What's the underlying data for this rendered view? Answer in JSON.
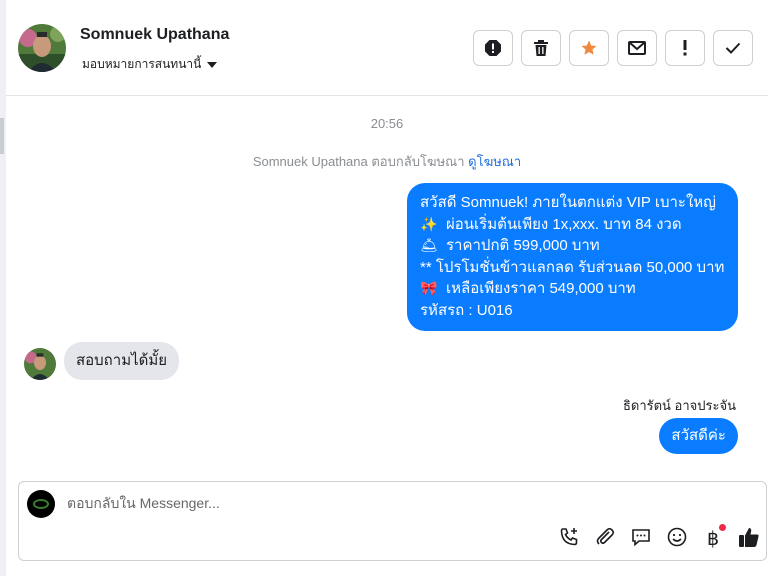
{
  "header": {
    "name": "Somnuek Upathana",
    "assign_label": "มอบหมายการสนทนานี้",
    "actions": [
      {
        "icon": "report-spam-icon"
      },
      {
        "icon": "trash-icon"
      },
      {
        "icon": "star-icon"
      },
      {
        "icon": "envelope-icon"
      },
      {
        "icon": "exclamation-icon"
      },
      {
        "icon": "checkmark-icon"
      }
    ]
  },
  "chat": {
    "timestamp": "20:56",
    "reply_note": "Somnuek Upathana ตอบกลับโฆษณา",
    "reply_note_link": "ดูโฆษณา",
    "outgoing_ad_message": {
      "line1": "สวัสดี Somnuek! ภายในตกแต่ง VIP เบาะใหญ่",
      "line2_emoji": "✨",
      "line2": "ผ่อนเริ่มต้นเพียง 1x,xxx. บาท 84 งวด",
      "line3_emoji": "🛎",
      "line3": "ราคาปกติ 599,000 บาท",
      "line4": "** โปรโมชั่นข้าวแลกลด รับส่วนลด 50,000 บาท",
      "line5_emoji": "🎀",
      "line5": "เหลือเพียงราคา 549,000 บาท",
      "line6": "รหัสรถ : U016"
    },
    "incoming_message": "สอบถามได้มั้ย",
    "sender_label": "ธิดารัตน์ อาจประจัน",
    "outgoing_reply": "สวัสดีค่ะ"
  },
  "composer": {
    "placeholder": "ตอบกลับใน Messenger...",
    "tools": [
      "phone-add-icon",
      "paperclip-icon",
      "chat-bubble-icon",
      "smiley-icon",
      "baht-icon",
      "thumbs-up-icon"
    ]
  },
  "colors": {
    "outgoing_bubble": "#0a7cff",
    "incoming_bubble": "#e4e6eb",
    "star": "#f0883e",
    "link": "#216fdb"
  }
}
